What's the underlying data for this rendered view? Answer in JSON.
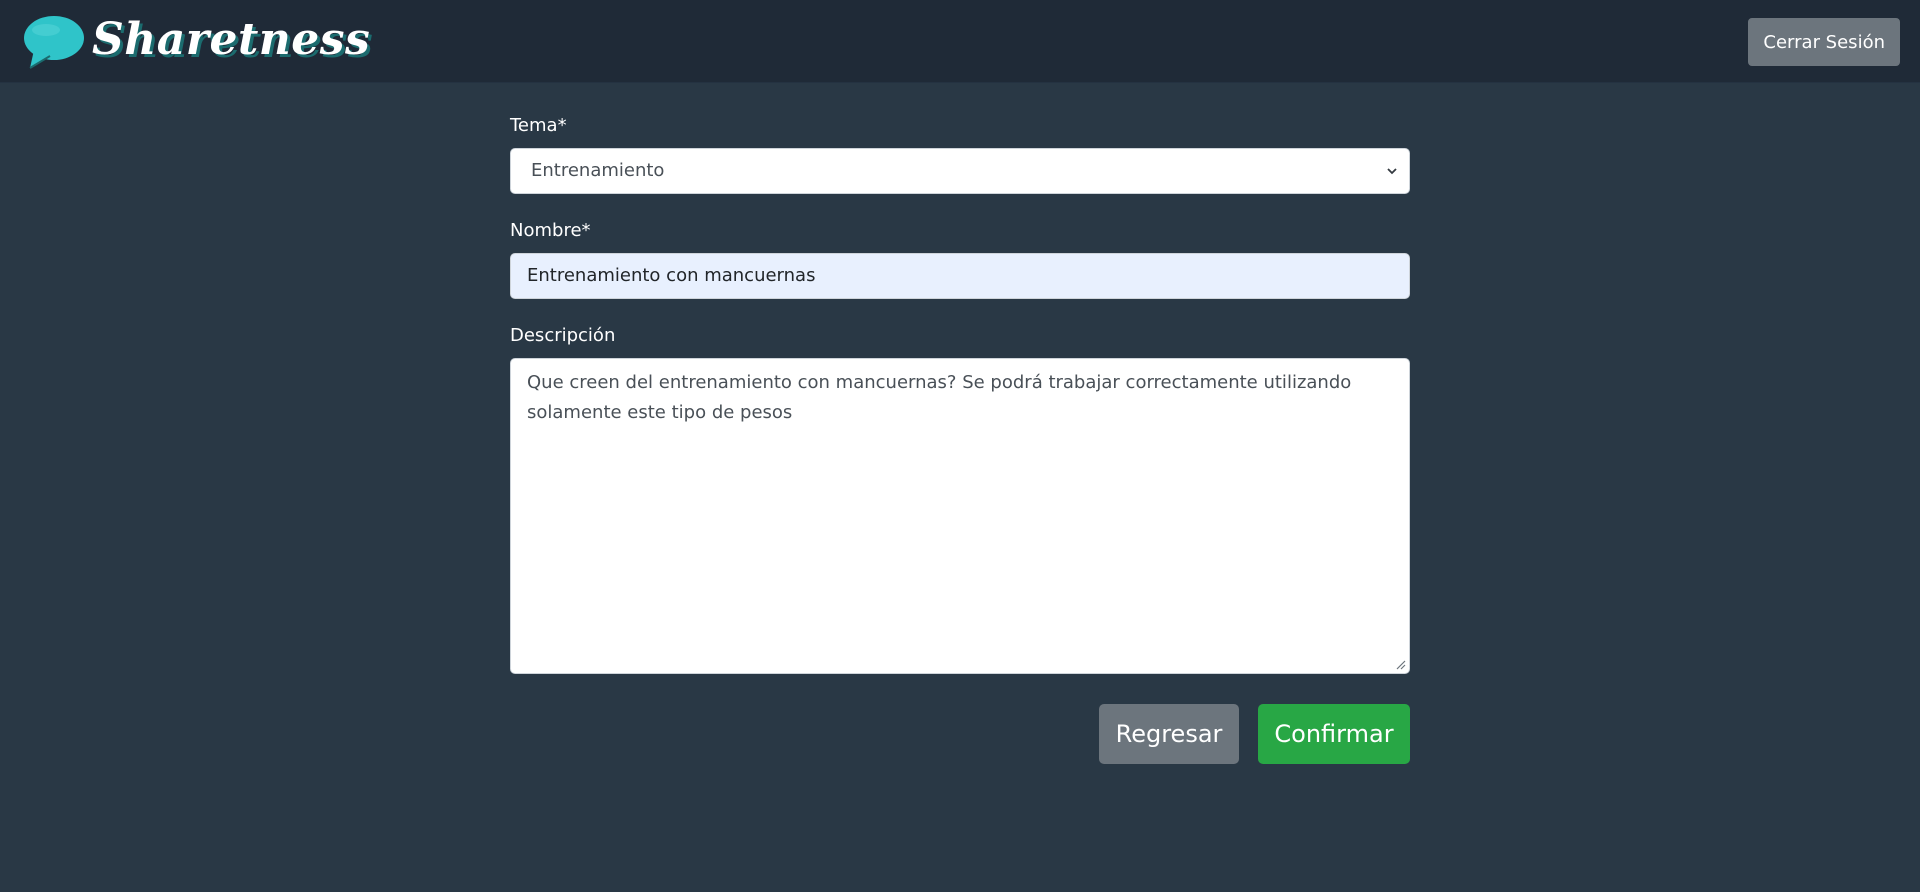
{
  "app": {
    "brand_name": "Sharetness",
    "logout_label": "Cerrar Sesión"
  },
  "form": {
    "topic_label": "Tema*",
    "topic_value": "Entrenamiento",
    "name_label": "Nombre*",
    "name_value": "Entrenamiento con mancuernas",
    "description_label": "Descripción",
    "description_value": "Que creen del entrenamiento con mancuernas? Se podrá trabajar correctamente utilizando solamente este tipo de pesos",
    "back_label": "Regresar",
    "confirm_label": "Confirmar"
  },
  "icons": {
    "brand": "speech-bubble-icon",
    "select": "chevron-down-icon",
    "resize": "resize-handle-icon"
  },
  "colors": {
    "background": "#293845",
    "navbar": "#1f2a37",
    "brand_accent": "#2fc4c9",
    "secondary_button": "#6c757d",
    "success_button": "#28a745",
    "autofill_field": "#e8f0fe"
  }
}
